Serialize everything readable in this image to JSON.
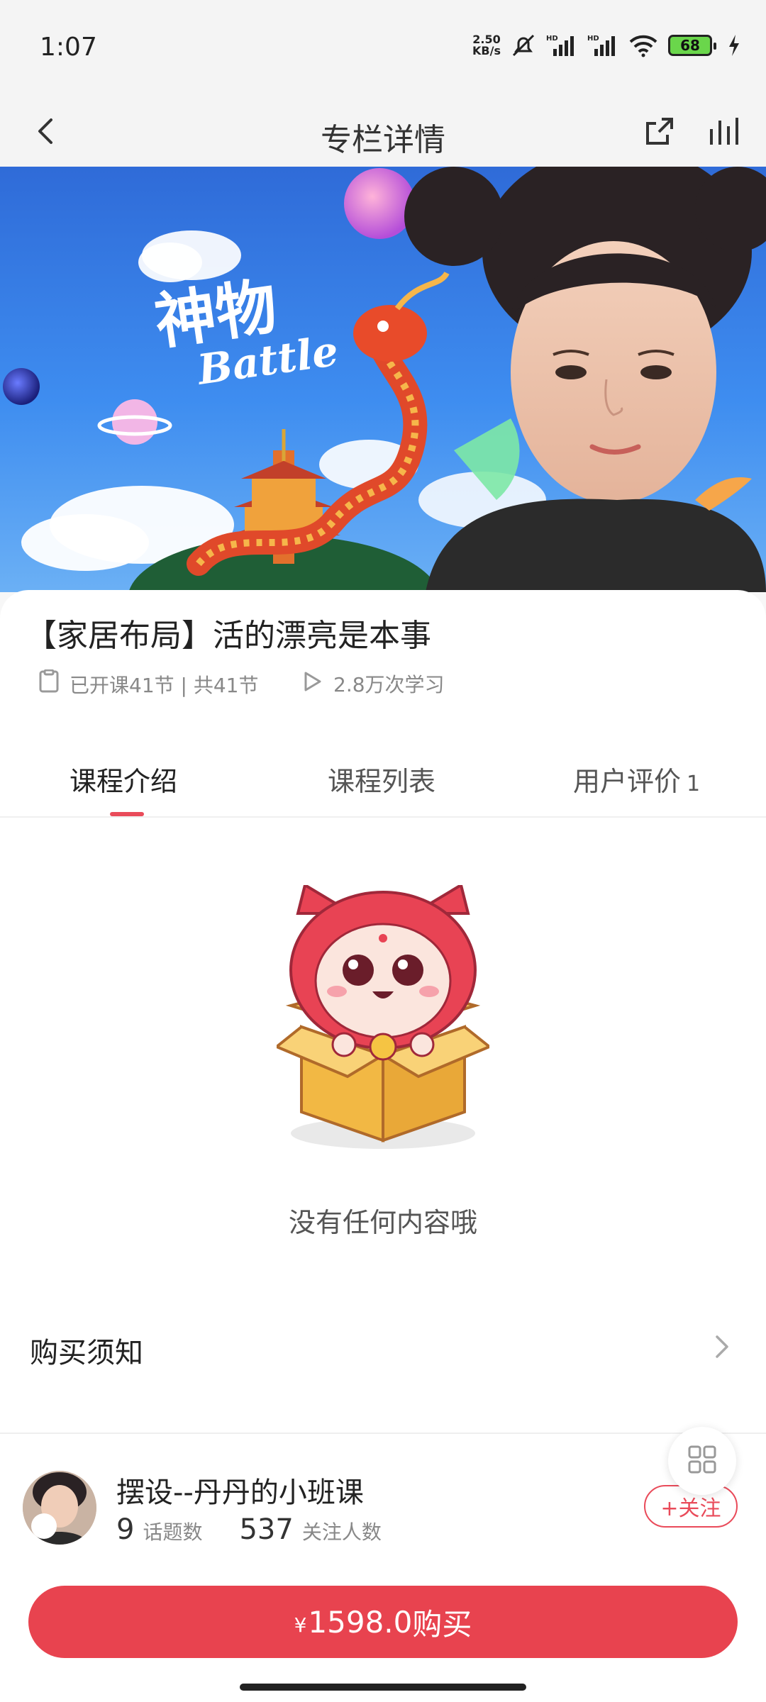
{
  "status_bar": {
    "time": "1:07",
    "net_speed_value": "2.50",
    "net_speed_unit": "KB/s",
    "battery": "68",
    "icons": [
      "mute-bell-icon",
      "signal-hd-icon",
      "signal-hd-icon",
      "wifi-icon",
      "battery-icon",
      "charging-icon"
    ]
  },
  "nav": {
    "title": "专栏详情",
    "icons": [
      "back-arrow-icon",
      "share-icon",
      "stats-icon"
    ]
  },
  "banner": {
    "logo_text": "神物",
    "logo_sub": "Battle"
  },
  "course": {
    "title": "【家居布局】活的漂亮是本事",
    "lessons": "已开课41节 | 共41节",
    "views": "2.8万次学习"
  },
  "tabs": [
    {
      "label": "课程介绍",
      "active": true
    },
    {
      "label": "课程列表",
      "active": false
    },
    {
      "label": "用户评价",
      "count": "1",
      "active": false
    }
  ],
  "content": {
    "empty_text": "没有任何内容哦",
    "notice_label": "购买须知"
  },
  "author": {
    "name": "摆设--丹丹的小班课",
    "topics_count": "9",
    "topics_label": "话题数",
    "followers_count": "537",
    "followers_label": "关注人数",
    "follow_label": "+关注"
  },
  "buy": {
    "currency": "¥",
    "price": "1598.0",
    "label": "购买"
  },
  "colors": {
    "accent": "#e8434f",
    "tab_indicator": "#e94b5a"
  }
}
